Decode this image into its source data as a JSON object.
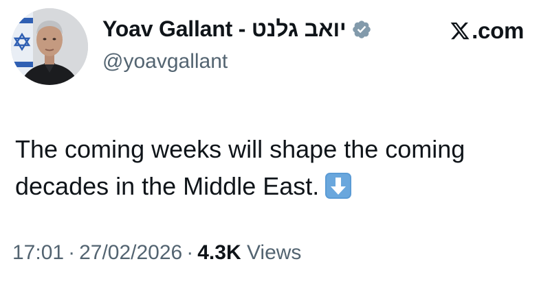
{
  "author": {
    "display_name": "Yoav Gallant - יואב גלנט",
    "handle": "@yoavgallant",
    "avatar_icon": "profile-photo",
    "verified_icon": "verified-badge-icon",
    "verified_color": "#829aab"
  },
  "brand": {
    "logo_icon": "x-logo-icon",
    "text": ".com"
  },
  "tweet": {
    "text": "The coming weeks will shape the coming decades in the Middle East.",
    "emoji_icon": "arrow-down-icon",
    "emoji_color": "#5b9bd5"
  },
  "meta": {
    "time": "17:01",
    "separator": "·",
    "date": "27/02/2026",
    "views_count": "4.3K",
    "views_label": "Views"
  },
  "colors": {
    "text_primary": "#0f1419",
    "text_secondary": "#536471",
    "background": "#ffffff"
  }
}
